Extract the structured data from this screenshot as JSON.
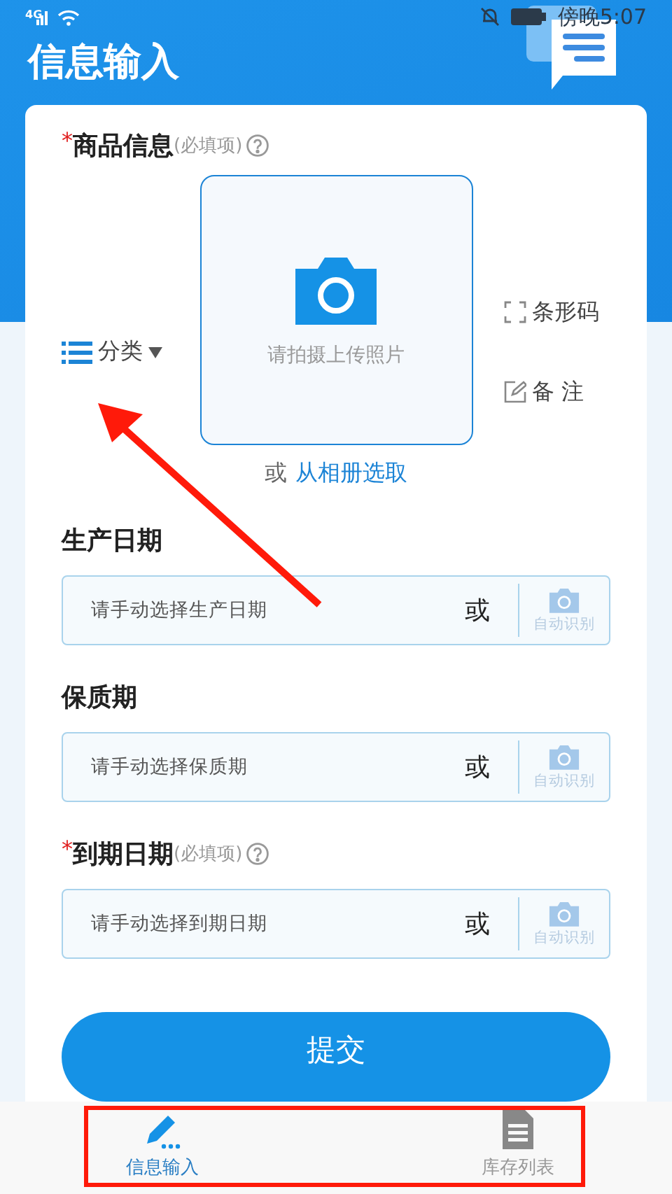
{
  "status_bar": {
    "network": "4G",
    "time": "傍晚5:07"
  },
  "title": "信息输入",
  "required_mark": "*",
  "product": {
    "label": "商品信息",
    "required": true,
    "hint": "(必填项)",
    "category": "分类",
    "photo_prompt": "请拍摄上传照片",
    "or_text": "或",
    "album_link": "从相册选取",
    "barcode": "条形码",
    "note": "备 注"
  },
  "fields": [
    {
      "label": "生产日期",
      "required": false,
      "placeholder": "请手动选择生产日期",
      "or_text": "或",
      "auto": "自动识别"
    },
    {
      "label": "保质期",
      "required": false,
      "placeholder": "请手动选择保质期",
      "or_text": "或",
      "auto": "自动识别"
    },
    {
      "label": "到期日期",
      "required": true,
      "hint": "(必填项)",
      "placeholder": "请手动选择到期日期",
      "or_text": "或",
      "auto": "自动识别"
    }
  ],
  "submit": "提交",
  "tabs": [
    {
      "label": "信息输入",
      "kind": "pencil",
      "selected": true
    },
    {
      "label": "库存列表",
      "kind": "document",
      "selected": false
    }
  ]
}
